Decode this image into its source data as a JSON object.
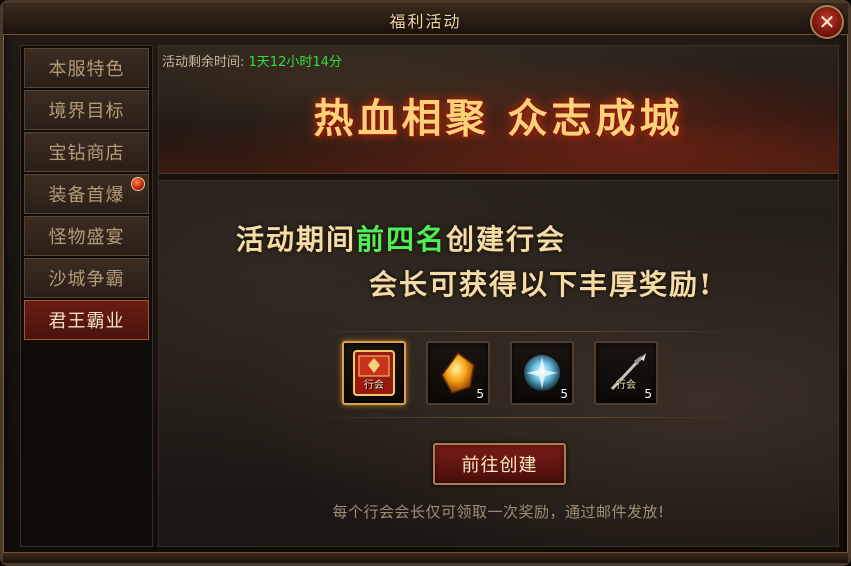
{
  "window": {
    "title": "福利活动"
  },
  "sidebar": {
    "items": [
      {
        "label": "本服特色",
        "active": false,
        "badge": false
      },
      {
        "label": "境界目标",
        "active": false,
        "badge": false
      },
      {
        "label": "宝钻商店",
        "active": false,
        "badge": false
      },
      {
        "label": "装备首爆",
        "active": false,
        "badge": true
      },
      {
        "label": "怪物盛宴",
        "active": false,
        "badge": false
      },
      {
        "label": "沙城争霸",
        "active": false,
        "badge": false
      },
      {
        "label": "君王霸业",
        "active": true,
        "badge": false
      }
    ]
  },
  "banner": {
    "countdown_label": "活动剩余时间:",
    "countdown_value": "1天12小时14分",
    "title": "热血相聚 众志成城"
  },
  "content": {
    "line1_pre": "活动期间",
    "line1_highlight": "前四名",
    "line1_post": "创建行会",
    "line2": "会长可获得以下丰厚奖励!",
    "rewards": [
      {
        "icon": "guild-token-icon",
        "label": "行会",
        "count": ""
      },
      {
        "icon": "gold-gem-icon",
        "label": "",
        "count": "5"
      },
      {
        "icon": "crystal-orb-icon",
        "label": "",
        "count": "5"
      },
      {
        "icon": "guild-spear-icon",
        "label": "行会",
        "count": "5"
      }
    ],
    "button_label": "前往创建",
    "note": "每个行会会长仅可领取一次奖励，通过邮件发放!"
  },
  "colors": {
    "highlight_green": "#4ef05a",
    "countdown_green": "#2fe040",
    "title_gold": "#ffd27a",
    "active_tab": "#6a1d14"
  }
}
